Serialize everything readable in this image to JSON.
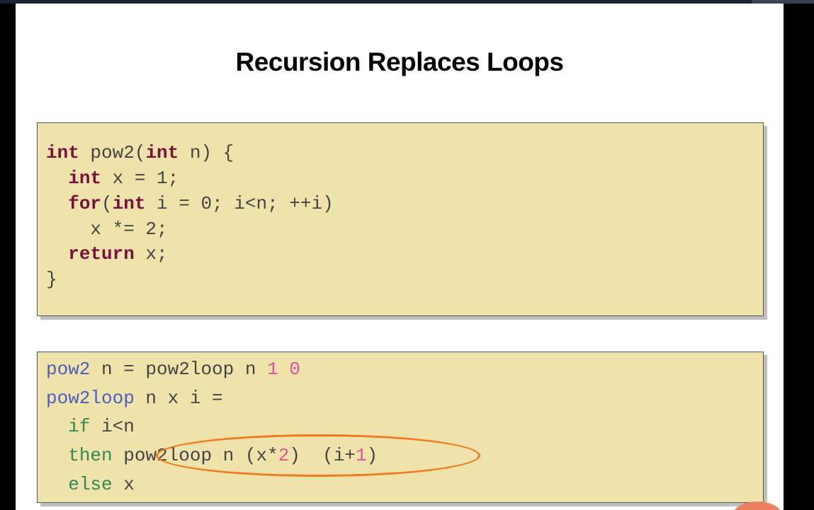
{
  "slide": {
    "title": "Recursion Replaces Loops"
  },
  "c_code": {
    "line1": {
      "kw1": "int",
      "t1": " pow2(",
      "kw2": "int",
      "t2": " n) {"
    },
    "line2": {
      "indent": "  ",
      "kw1": "int",
      "t1": " x = 1;"
    },
    "line3": {
      "indent": "  ",
      "kw1": "for",
      "t1": "(",
      "kw2": "int",
      "t2": " i = 0; i<n; ++i)"
    },
    "line4": {
      "t1": "    x *= 2;"
    },
    "line5": {
      "indent": "  ",
      "kw1": "return",
      "t1": " x;"
    },
    "line6": {
      "t1": "}"
    }
  },
  "haskell_code": {
    "line1": {
      "fn1": "pow2",
      "t1": " n = pow2loop n ",
      "n1": "1",
      "sp": " ",
      "n2": "0"
    },
    "line2": {
      "fn1": "pow2loop",
      "t1": " n x i ="
    },
    "line3": {
      "indent": "  ",
      "kw1": "if",
      "t1": " i<n"
    },
    "line4": {
      "indent": "  ",
      "kw1": "then",
      "t1": " pow2loop n (x*",
      "n1": "2",
      "t2": ")  (i+",
      "n2": "1",
      "t3": ")"
    },
    "line5": {
      "indent": "  ",
      "kw1": "else",
      "t1": " x"
    }
  },
  "colors": {
    "code_background": "#f0e2ab",
    "c_keyword": "#7a0f3c",
    "haskell_function": "#4a5fc1",
    "haskell_keyword": "#2f8a54",
    "number_literal": "#e0529f",
    "highlight_ellipse": "#f07a1c"
  }
}
